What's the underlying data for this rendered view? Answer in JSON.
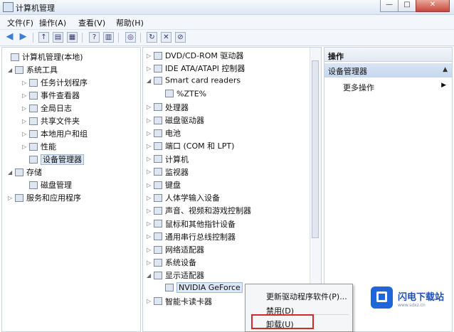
{
  "window": {
    "title": "计算机管理"
  },
  "menu": [
    "文件(F)",
    "操作(A)",
    "查看(V)",
    "帮助(H)"
  ],
  "left_tree": [
    {
      "label": "计算机管理(本地)",
      "twisty": "",
      "level": 0
    },
    {
      "label": "系统工具",
      "twisty": "◢",
      "level": 1
    },
    {
      "label": "任务计划程序",
      "twisty": "▷",
      "level": 2
    },
    {
      "label": "事件查看器",
      "twisty": "▷",
      "level": 2
    },
    {
      "label": "全局日志",
      "twisty": "▷",
      "level": 2
    },
    {
      "label": "共享文件夹",
      "twisty": "▷",
      "level": 2
    },
    {
      "label": "本地用户和组",
      "twisty": "▷",
      "level": 2
    },
    {
      "label": "性能",
      "twisty": "▷",
      "level": 2
    },
    {
      "label": "设备管理器",
      "twisty": "",
      "level": 2,
      "selected": true
    },
    {
      "label": "存储",
      "twisty": "◢",
      "level": 1
    },
    {
      "label": "磁盘管理",
      "twisty": "",
      "level": 2
    },
    {
      "label": "服务和应用程序",
      "twisty": "▷",
      "level": 1
    }
  ],
  "device_tree": [
    {
      "label": "DVD/CD-ROM 驱动器",
      "twisty": "▷",
      "level": 0
    },
    {
      "label": "IDE ATA/ATAPI 控制器",
      "twisty": "▷",
      "level": 0
    },
    {
      "label": "Smart card readers",
      "twisty": "◢",
      "level": 0
    },
    {
      "label": "%ZTE%",
      "twisty": "",
      "level": 1
    },
    {
      "label": "处理器",
      "twisty": "▷",
      "level": 0
    },
    {
      "label": "磁盘驱动器",
      "twisty": "▷",
      "level": 0
    },
    {
      "label": "电池",
      "twisty": "▷",
      "level": 0
    },
    {
      "label": "端口 (COM 和 LPT)",
      "twisty": "▷",
      "level": 0
    },
    {
      "label": "计算机",
      "twisty": "▷",
      "level": 0
    },
    {
      "label": "监视器",
      "twisty": "▷",
      "level": 0
    },
    {
      "label": "键盘",
      "twisty": "▷",
      "level": 0
    },
    {
      "label": "人体学输入设备",
      "twisty": "▷",
      "level": 0
    },
    {
      "label": "声音、视频和游戏控制器",
      "twisty": "▷",
      "level": 0
    },
    {
      "label": "鼠标和其他指针设备",
      "twisty": "▷",
      "level": 0
    },
    {
      "label": "通用串行总线控制器",
      "twisty": "▷",
      "level": 0
    },
    {
      "label": "网络适配器",
      "twisty": "▷",
      "level": 0
    },
    {
      "label": "系统设备",
      "twisty": "▷",
      "level": 0
    },
    {
      "label": "显示适配器",
      "twisty": "◢",
      "level": 0
    },
    {
      "label": "NVIDIA GeForce",
      "twisty": "",
      "level": 1,
      "selected": true
    },
    {
      "label": "智能卡读卡器",
      "twisty": "▷",
      "level": 0
    }
  ],
  "actions_panel": {
    "header": "操作",
    "section": "设备管理器",
    "more": "更多操作"
  },
  "context_menu": [
    {
      "label": "更新驱动程序软件(P)..."
    },
    {
      "label": "禁用(D)"
    },
    {
      "label": "卸载(U)",
      "highlighted": true
    }
  ],
  "watermark": {
    "name": "闪电下载站",
    "url": "www.sdxz.cn"
  },
  "colors": {
    "highlight_border": "#d12a2a",
    "selection": "#dce8f7",
    "accent": "#1f66d9"
  }
}
